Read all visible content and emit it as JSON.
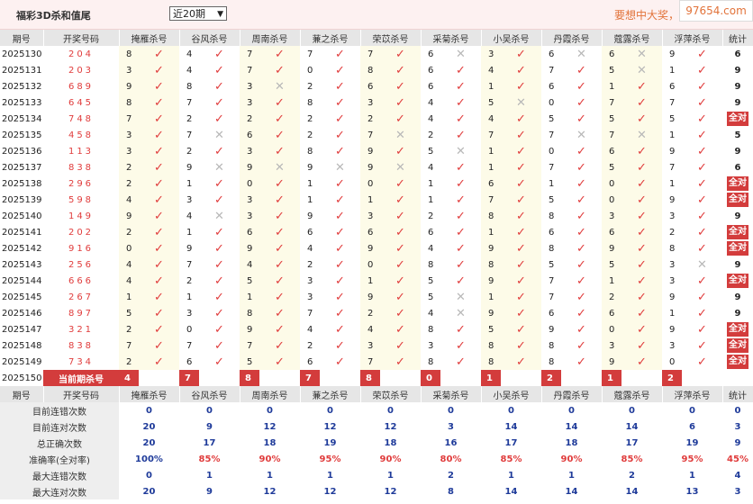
{
  "header": {
    "title": "福彩3D杀和值尾",
    "range_selected": "近20期",
    "slogan": "要想中大奖，天天",
    "watermark": "97654.com"
  },
  "columns": {
    "issue": "期号",
    "code": "开奖号码",
    "experts": [
      "掩雁杀号",
      "谷风杀号",
      "周南杀号",
      "蒹之杀号",
      "荣苡杀号",
      "采菊杀号",
      "小吴杀号",
      "丹霞杀号",
      "蔻露杀号",
      "浮萍杀号"
    ],
    "stat": "统计"
  },
  "rows": [
    {
      "issue": "2025130",
      "code": "204",
      "kills": [
        [
          8,
          1
        ],
        [
          4,
          1
        ],
        [
          7,
          1
        ],
        [
          7,
          1
        ],
        [
          7,
          1
        ],
        [
          6,
          0
        ],
        [
          3,
          1
        ],
        [
          6,
          0
        ],
        [
          6,
          0
        ],
        [
          9,
          1
        ]
      ],
      "stat": "6"
    },
    {
      "issue": "2025131",
      "code": "203",
      "kills": [
        [
          3,
          1
        ],
        [
          4,
          1
        ],
        [
          7,
          1
        ],
        [
          0,
          1
        ],
        [
          8,
          1
        ],
        [
          6,
          1
        ],
        [
          4,
          1
        ],
        [
          7,
          1
        ],
        [
          5,
          0
        ],
        [
          1,
          1
        ]
      ],
      "stat": "9"
    },
    {
      "issue": "2025132",
      "code": "689",
      "kills": [
        [
          9,
          1
        ],
        [
          8,
          1
        ],
        [
          3,
          0
        ],
        [
          2,
          1
        ],
        [
          6,
          1
        ],
        [
          6,
          1
        ],
        [
          1,
          1
        ],
        [
          6,
          1
        ],
        [
          1,
          1
        ],
        [
          6,
          1
        ]
      ],
      "stat": "9"
    },
    {
      "issue": "2025133",
      "code": "645",
      "kills": [
        [
          8,
          1
        ],
        [
          7,
          1
        ],
        [
          3,
          1
        ],
        [
          8,
          1
        ],
        [
          3,
          1
        ],
        [
          4,
          1
        ],
        [
          5,
          0
        ],
        [
          0,
          1
        ],
        [
          7,
          1
        ],
        [
          7,
          1
        ]
      ],
      "stat": "9"
    },
    {
      "issue": "2025134",
      "code": "748",
      "kills": [
        [
          7,
          1
        ],
        [
          2,
          1
        ],
        [
          2,
          1
        ],
        [
          2,
          1
        ],
        [
          2,
          1
        ],
        [
          4,
          1
        ],
        [
          4,
          1
        ],
        [
          5,
          1
        ],
        [
          5,
          1
        ],
        [
          5,
          1
        ]
      ],
      "stat": "全对"
    },
    {
      "issue": "2025135",
      "code": "458",
      "kills": [
        [
          3,
          1
        ],
        [
          7,
          0
        ],
        [
          6,
          1
        ],
        [
          2,
          1
        ],
        [
          7,
          0
        ],
        [
          2,
          1
        ],
        [
          7,
          1
        ],
        [
          7,
          0
        ],
        [
          7,
          0
        ],
        [
          1,
          1
        ]
      ],
      "stat": "5"
    },
    {
      "issue": "2025136",
      "code": "113",
      "kills": [
        [
          3,
          1
        ],
        [
          2,
          1
        ],
        [
          3,
          1
        ],
        [
          8,
          1
        ],
        [
          9,
          1
        ],
        [
          5,
          0
        ],
        [
          1,
          1
        ],
        [
          0,
          1
        ],
        [
          6,
          1
        ],
        [
          9,
          1
        ]
      ],
      "stat": "9"
    },
    {
      "issue": "2025137",
      "code": "838",
      "kills": [
        [
          2,
          1
        ],
        [
          9,
          0
        ],
        [
          9,
          0
        ],
        [
          9,
          0
        ],
        [
          9,
          0
        ],
        [
          4,
          1
        ],
        [
          1,
          1
        ],
        [
          7,
          1
        ],
        [
          5,
          1
        ],
        [
          7,
          1
        ]
      ],
      "stat": "6"
    },
    {
      "issue": "2025138",
      "code": "296",
      "kills": [
        [
          2,
          1
        ],
        [
          1,
          1
        ],
        [
          0,
          1
        ],
        [
          1,
          1
        ],
        [
          0,
          1
        ],
        [
          1,
          1
        ],
        [
          6,
          1
        ],
        [
          1,
          1
        ],
        [
          0,
          1
        ],
        [
          1,
          1
        ]
      ],
      "stat": "全对"
    },
    {
      "issue": "2025139",
      "code": "598",
      "kills": [
        [
          4,
          1
        ],
        [
          3,
          1
        ],
        [
          3,
          1
        ],
        [
          1,
          1
        ],
        [
          1,
          1
        ],
        [
          1,
          1
        ],
        [
          7,
          1
        ],
        [
          5,
          1
        ],
        [
          0,
          1
        ],
        [
          9,
          1
        ]
      ],
      "stat": "全对"
    },
    {
      "issue": "2025140",
      "code": "149",
      "kills": [
        [
          9,
          1
        ],
        [
          4,
          0
        ],
        [
          3,
          1
        ],
        [
          9,
          1
        ],
        [
          3,
          1
        ],
        [
          2,
          1
        ],
        [
          8,
          1
        ],
        [
          8,
          1
        ],
        [
          3,
          1
        ],
        [
          3,
          1
        ]
      ],
      "stat": "9"
    },
    {
      "issue": "2025141",
      "code": "202",
      "kills": [
        [
          2,
          1
        ],
        [
          1,
          1
        ],
        [
          6,
          1
        ],
        [
          6,
          1
        ],
        [
          6,
          1
        ],
        [
          6,
          1
        ],
        [
          1,
          1
        ],
        [
          6,
          1
        ],
        [
          6,
          1
        ],
        [
          2,
          1
        ]
      ],
      "stat": "全对"
    },
    {
      "issue": "2025142",
      "code": "916",
      "kills": [
        [
          0,
          1
        ],
        [
          9,
          1
        ],
        [
          9,
          1
        ],
        [
          4,
          1
        ],
        [
          9,
          1
        ],
        [
          4,
          1
        ],
        [
          9,
          1
        ],
        [
          8,
          1
        ],
        [
          9,
          1
        ],
        [
          8,
          1
        ]
      ],
      "stat": "全对"
    },
    {
      "issue": "2025143",
      "code": "256",
      "kills": [
        [
          4,
          1
        ],
        [
          7,
          1
        ],
        [
          4,
          1
        ],
        [
          2,
          1
        ],
        [
          0,
          1
        ],
        [
          8,
          1
        ],
        [
          8,
          1
        ],
        [
          5,
          1
        ],
        [
          5,
          1
        ],
        [
          3,
          0
        ]
      ],
      "stat": "9"
    },
    {
      "issue": "2025144",
      "code": "666",
      "kills": [
        [
          4,
          1
        ],
        [
          2,
          1
        ],
        [
          5,
          1
        ],
        [
          3,
          1
        ],
        [
          1,
          1
        ],
        [
          5,
          1
        ],
        [
          9,
          1
        ],
        [
          7,
          1
        ],
        [
          1,
          1
        ],
        [
          3,
          1
        ]
      ],
      "stat": "全对"
    },
    {
      "issue": "2025145",
      "code": "267",
      "kills": [
        [
          1,
          1
        ],
        [
          1,
          1
        ],
        [
          1,
          1
        ],
        [
          3,
          1
        ],
        [
          9,
          1
        ],
        [
          5,
          0
        ],
        [
          1,
          1
        ],
        [
          7,
          1
        ],
        [
          2,
          1
        ],
        [
          9,
          1
        ]
      ],
      "stat": "9"
    },
    {
      "issue": "2025146",
      "code": "897",
      "kills": [
        [
          5,
          1
        ],
        [
          3,
          1
        ],
        [
          8,
          1
        ],
        [
          7,
          1
        ],
        [
          2,
          1
        ],
        [
          4,
          0
        ],
        [
          9,
          1
        ],
        [
          6,
          1
        ],
        [
          6,
          1
        ],
        [
          1,
          1
        ]
      ],
      "stat": "9"
    },
    {
      "issue": "2025147",
      "code": "321",
      "kills": [
        [
          2,
          1
        ],
        [
          0,
          1
        ],
        [
          9,
          1
        ],
        [
          4,
          1
        ],
        [
          4,
          1
        ],
        [
          8,
          1
        ],
        [
          5,
          1
        ],
        [
          9,
          1
        ],
        [
          0,
          1
        ],
        [
          9,
          1
        ]
      ],
      "stat": "全对"
    },
    {
      "issue": "2025148",
      "code": "838",
      "kills": [
        [
          7,
          1
        ],
        [
          7,
          1
        ],
        [
          7,
          1
        ],
        [
          2,
          1
        ],
        [
          3,
          1
        ],
        [
          3,
          1
        ],
        [
          8,
          1
        ],
        [
          8,
          1
        ],
        [
          3,
          1
        ],
        [
          3,
          1
        ]
      ],
      "stat": "全对"
    },
    {
      "issue": "2025149",
      "code": "734",
      "kills": [
        [
          2,
          1
        ],
        [
          6,
          1
        ],
        [
          5,
          1
        ],
        [
          6,
          1
        ],
        [
          7,
          1
        ],
        [
          8,
          1
        ],
        [
          8,
          1
        ],
        [
          8,
          1
        ],
        [
          9,
          1
        ],
        [
          0,
          1
        ]
      ],
      "stat": "全对"
    }
  ],
  "current": {
    "issue": "2025150",
    "label": "当前期杀号",
    "kills": [
      "4",
      "7",
      "8",
      "7",
      "8",
      "0",
      "1",
      "2",
      "1",
      "2"
    ]
  },
  "marks": {
    "hit": "✓",
    "miss": "✕"
  },
  "stats": [
    {
      "label": "目前连错次数",
      "values": [
        "0",
        "0",
        "0",
        "0",
        "0",
        "0",
        "0",
        "0",
        "0",
        "0"
      ],
      "total": "0"
    },
    {
      "label": "目前连对次数",
      "values": [
        "20",
        "9",
        "12",
        "12",
        "12",
        "3",
        "14",
        "14",
        "14",
        "6"
      ],
      "total": "3"
    },
    {
      "label": "总正确次数",
      "values": [
        "20",
        "17",
        "18",
        "19",
        "18",
        "16",
        "17",
        "18",
        "17",
        "19"
      ],
      "total": "9"
    },
    {
      "label": "准确率(全对率)",
      "values": [
        "100%",
        "85%",
        "90%",
        "95%",
        "90%",
        "80%",
        "85%",
        "90%",
        "85%",
        "95%"
      ],
      "total": "45%"
    },
    {
      "label": "最大连错次数",
      "values": [
        "0",
        "1",
        "1",
        "1",
        "1",
        "2",
        "1",
        "1",
        "2",
        "1"
      ],
      "total": "4"
    },
    {
      "label": "最大连对次数",
      "values": [
        "20",
        "9",
        "12",
        "12",
        "12",
        "8",
        "14",
        "14",
        "14",
        "13"
      ],
      "total": "3"
    }
  ]
}
